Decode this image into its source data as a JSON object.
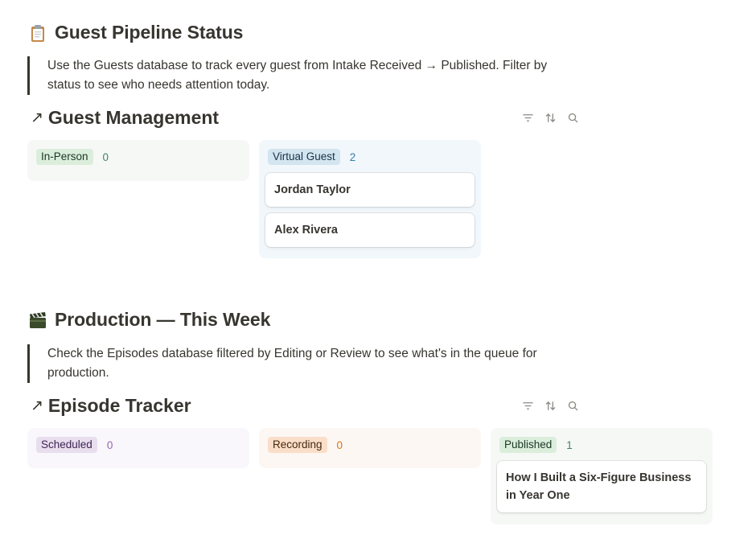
{
  "section1": {
    "title": "Guest Pipeline Status",
    "icon": "clipboard-icon",
    "quote": "Use the Guests database to track every guest from Intake Received → Published. Filter by status to see who needs attention today."
  },
  "guest_db": {
    "arrow": "↗",
    "title": "Guest Management",
    "columns": [
      {
        "tag": "In-Person",
        "count": "0",
        "tag_bg": "#dbeddb",
        "tag_color": "#1c3829",
        "count_color": "#448361",
        "col_bg": "#f6f8f6"
      },
      {
        "tag": "Virtual Guest",
        "count": "2",
        "tag_bg": "#d3e5ef",
        "tag_color": "#183347",
        "count_color": "#337ea9",
        "col_bg": "#f1f7fb",
        "cards": [
          "Jordan Taylor",
          "Alex Rivera"
        ]
      }
    ]
  },
  "section2": {
    "title": "Production — This Week",
    "icon": "clapperboard-icon",
    "quote": "Check the Episodes database filtered by Editing or Review to see what's in the queue for production."
  },
  "episode_db": {
    "arrow": "↗",
    "title": "Episode Tracker",
    "columns": [
      {
        "tag": "Scheduled",
        "count": "0",
        "tag_bg": "#e8deee",
        "tag_color": "#412454",
        "count_color": "#9065b0",
        "col_bg": "#faf7fc"
      },
      {
        "tag": "Recording",
        "count": "0",
        "tag_bg": "#fadec9",
        "tag_color": "#49290e",
        "count_color": "#d9730d",
        "col_bg": "#fdf7f3"
      },
      {
        "tag": "Published",
        "count": "1",
        "tag_bg": "#dbeddb",
        "tag_color": "#1c3829",
        "count_color": "#448361",
        "col_bg": "#f6f8f6",
        "cards": [
          "How I Built a Six-Figure Business in Year One"
        ]
      }
    ]
  },
  "toolbar_icons": [
    "filter-icon",
    "sort-icon",
    "search-icon"
  ]
}
